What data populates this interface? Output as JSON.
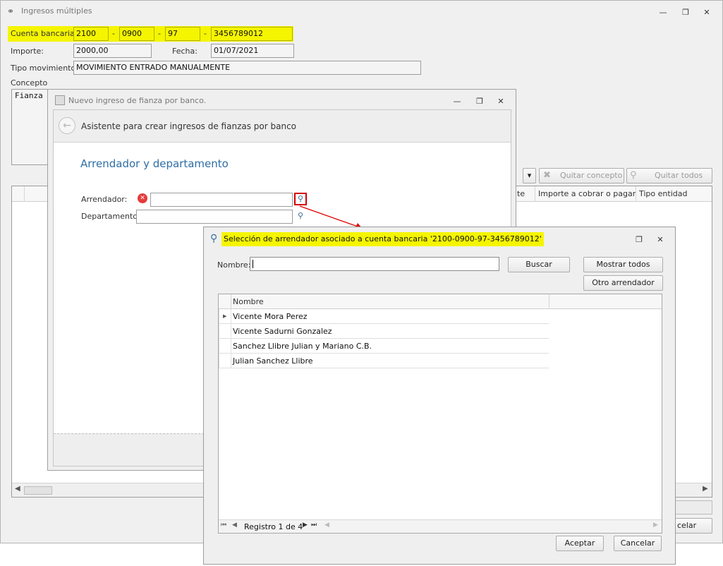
{
  "main_window": {
    "title": "Ingresos múltiples",
    "account_label": "Cuenta bancaria:",
    "account_parts": [
      "2100",
      "0900",
      "97",
      "3456789012"
    ],
    "separator": "-",
    "amount_label": "Importe:",
    "amount_value": "2000,00",
    "date_label": "Fecha:",
    "date_value": "01/07/2021",
    "movement_label": "Tipo movimiento:",
    "movement_value": "MOVIMIENTO ENTRADO MANUALMENTE",
    "concept_label": "Concepto",
    "concept_value": "Fianza",
    "remove_concept_label": "Quitar concepto",
    "remove_all_label": "Quitar todos",
    "columns": [
      "te",
      "Importe a cobrar o pagar",
      "Tipo entidad"
    ],
    "cancel_fragment": "celar"
  },
  "wizard": {
    "title": "Nuevo ingreso de fianza por banco.",
    "header": "Asistente para crear ingresos de fianzas por banco",
    "section_title": "Arrendador y departamento",
    "landlord_label": "Arrendador:",
    "department_label": "Departamento:"
  },
  "dialog": {
    "title": "Selección de arrendador asociado a cuenta bancaria '2100-0900-97-3456789012'",
    "name_label": "Nombre:",
    "name_value": "",
    "search_label": "Buscar",
    "show_all_label": "Mostrar todos",
    "other_label": "Otro arrendador",
    "column_name": "Nombre",
    "rows": [
      "Vicente Mora Perez",
      "Vicente Sadurni Gonzalez",
      "Sanchez Llibre Julian y Mariano C.B.",
      "Julian Sanchez Llibre"
    ],
    "record_text": "Registro 1 de 4",
    "accept_label": "Aceptar",
    "cancel_label": "Cancelar"
  },
  "colors": {
    "highlight": "#f5f500",
    "link_blue": "#2e6ea6",
    "arrow_red": "#e00000"
  },
  "icons": [
    "link-icon",
    "minimize-icon",
    "restore-icon",
    "close-icon",
    "back-arrow-icon",
    "error-icon",
    "magnifier-icon",
    "x-icon",
    "broom-icon",
    "row-pointer-icon"
  ]
}
